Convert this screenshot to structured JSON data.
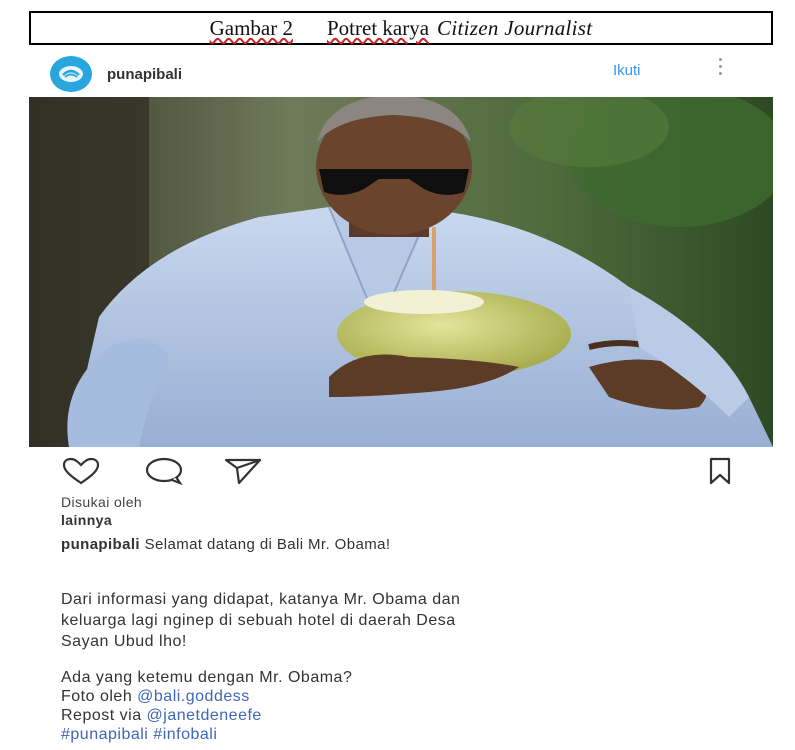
{
  "caption": {
    "gambar": "Gambar 2",
    "potret": "Potret karya",
    "source": "Citizen Journalist"
  },
  "post": {
    "username": "punapibali",
    "follow_label": "Ikuti",
    "more_icon": "more-vertical-icon",
    "avatar_icon": "punapibali-logo",
    "actions": {
      "like_icon": "heart-icon",
      "comment_icon": "comment-icon",
      "share_icon": "send-icon",
      "save_icon": "bookmark-icon"
    },
    "likes_line1": "Disukai oleh",
    "likes_line2": "lainnya",
    "caption_user": "punapibali",
    "caption_text": "Selamat datang di Bali Mr. Obama!",
    "body_line1": "Dari informasi yang didapat, katanya Mr. Obama dan",
    "body_line2": "keluarga lagi nginep di sebuah hotel di daerah Desa",
    "body_line3": "Sayan Ubud lho!",
    "question": "Ada yang ketemu dengan Mr. Obama?",
    "photo_prefix": "Foto oleh ",
    "photo_credit": "@bali.goddess",
    "repost_prefix": "Repost via ",
    "repost_credit": "@janetdeneefe",
    "hashtags": "#punapibali #infobali"
  },
  "colors": {
    "link": "#3f67b7",
    "follow": "#3897f0",
    "avatar": "#2aa6df"
  }
}
